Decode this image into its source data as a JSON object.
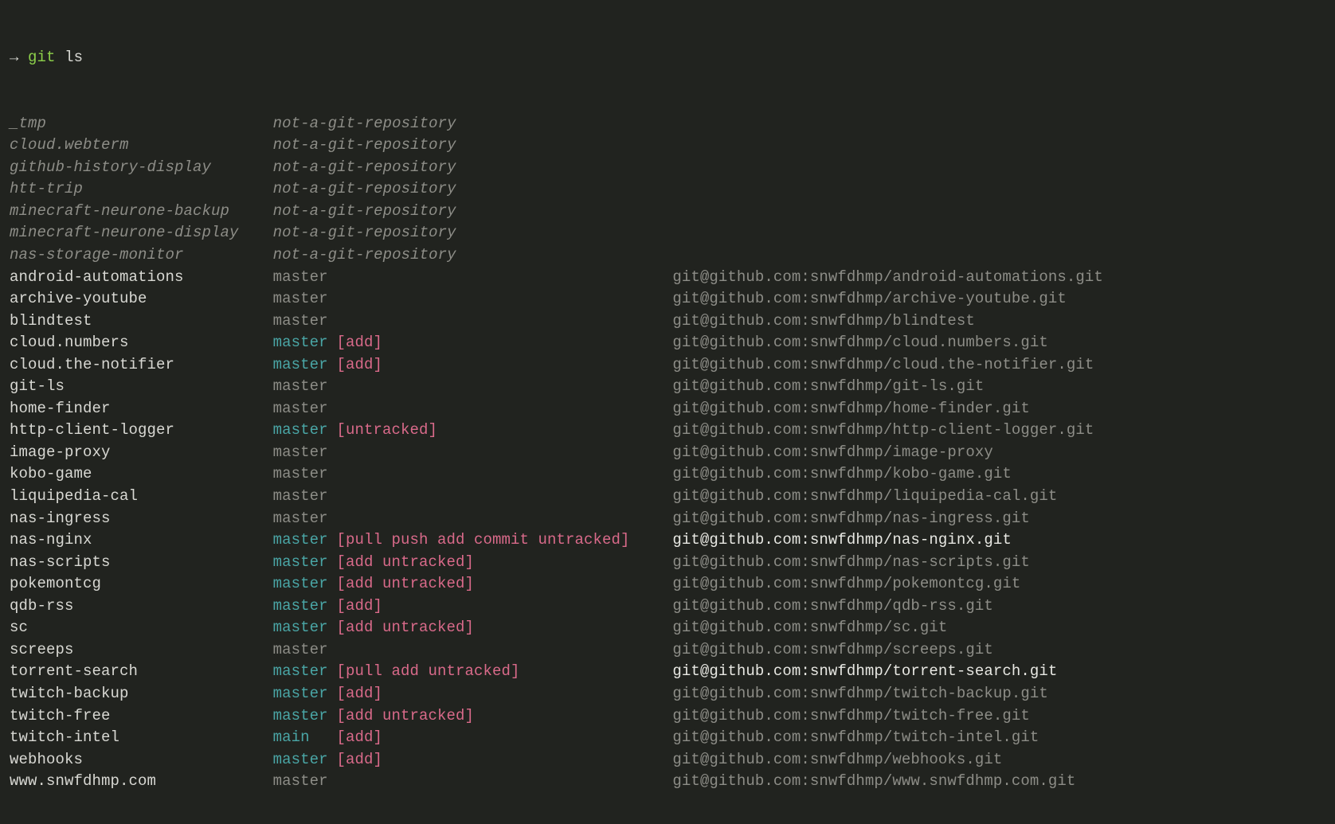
{
  "prompt": {
    "arrow": "→",
    "cmd": "git",
    "arg": "ls"
  },
  "notgit_label": "not-a-git-repository",
  "notgit": [
    "_tmp",
    "cloud.webterm",
    "github-history-display",
    "htt-trip",
    "minecraft-neurone-backup",
    "minecraft-neurone-display",
    "nas-storage-monitor"
  ],
  "repos": [
    {
      "dir": "android-automations",
      "branch": "master",
      "flags": "",
      "remote": "git@github.com:snwfdhmp/android-automations.git",
      "bright": false
    },
    {
      "dir": "archive-youtube",
      "branch": "master",
      "flags": "",
      "remote": "git@github.com:snwfdhmp/archive-youtube.git",
      "bright": false
    },
    {
      "dir": "blindtest",
      "branch": "master",
      "flags": "",
      "remote": "git@github.com:snwfdhmp/blindtest",
      "bright": false
    },
    {
      "dir": "cloud.numbers",
      "branch": "master",
      "flags": "[add]",
      "remote": "git@github.com:snwfdhmp/cloud.numbers.git",
      "bright": false
    },
    {
      "dir": "cloud.the-notifier",
      "branch": "master",
      "flags": "[add]",
      "remote": "git@github.com:snwfdhmp/cloud.the-notifier.git",
      "bright": false
    },
    {
      "dir": "git-ls",
      "branch": "master",
      "flags": "",
      "remote": "git@github.com:snwfdhmp/git-ls.git",
      "bright": false
    },
    {
      "dir": "home-finder",
      "branch": "master",
      "flags": "",
      "remote": "git@github.com:snwfdhmp/home-finder.git",
      "bright": false
    },
    {
      "dir": "http-client-logger",
      "branch": "master",
      "flags": "[untracked]",
      "remote": "git@github.com:snwfdhmp/http-client-logger.git",
      "bright": false
    },
    {
      "dir": "image-proxy",
      "branch": "master",
      "flags": "",
      "remote": "git@github.com:snwfdhmp/image-proxy",
      "bright": false
    },
    {
      "dir": "kobo-game",
      "branch": "master",
      "flags": "",
      "remote": "git@github.com:snwfdhmp/kobo-game.git",
      "bright": false
    },
    {
      "dir": "liquipedia-cal",
      "branch": "master",
      "flags": "",
      "remote": "git@github.com:snwfdhmp/liquipedia-cal.git",
      "bright": false
    },
    {
      "dir": "nas-ingress",
      "branch": "master",
      "flags": "",
      "remote": "git@github.com:snwfdhmp/nas-ingress.git",
      "bright": false
    },
    {
      "dir": "nas-nginx",
      "branch": "master",
      "flags": "[pull push add commit untracked]",
      "remote": "git@github.com:snwfdhmp/nas-nginx.git",
      "bright": true
    },
    {
      "dir": "nas-scripts",
      "branch": "master",
      "flags": "[add untracked]",
      "remote": "git@github.com:snwfdhmp/nas-scripts.git",
      "bright": false
    },
    {
      "dir": "pokemontcg",
      "branch": "master",
      "flags": "[add untracked]",
      "remote": "git@github.com:snwfdhmp/pokemontcg.git",
      "bright": false
    },
    {
      "dir": "qdb-rss",
      "branch": "master",
      "flags": "[add]",
      "remote": "git@github.com:snwfdhmp/qdb-rss.git",
      "bright": false
    },
    {
      "dir": "sc",
      "branch": "master",
      "flags": "[add untracked]",
      "remote": "git@github.com:snwfdhmp/sc.git",
      "bright": false
    },
    {
      "dir": "screeps",
      "branch": "master",
      "flags": "",
      "remote": "git@github.com:snwfdhmp/screeps.git",
      "bright": false
    },
    {
      "dir": "torrent-search",
      "branch": "master",
      "flags": "[pull add untracked]",
      "remote": "git@github.com:snwfdhmp/torrent-search.git",
      "bright": true
    },
    {
      "dir": "twitch-backup",
      "branch": "master",
      "flags": "[add]",
      "remote": "git@github.com:snwfdhmp/twitch-backup.git",
      "bright": false
    },
    {
      "dir": "twitch-free",
      "branch": "master",
      "flags": "[add untracked]",
      "remote": "git@github.com:snwfdhmp/twitch-free.git",
      "bright": false
    },
    {
      "dir": "twitch-intel",
      "branch": "main",
      "flags": "[add]",
      "remote": "git@github.com:snwfdhmp/twitch-intel.git",
      "bright": false
    },
    {
      "dir": "webhooks",
      "branch": "master",
      "flags": "[add]",
      "remote": "git@github.com:snwfdhmp/webhooks.git",
      "bright": false
    },
    {
      "dir": "www.snwfdhmp.com",
      "branch": "master",
      "flags": "",
      "remote": "git@github.com:snwfdhmp/www.snwfdhmp.com.git",
      "bright": false
    }
  ]
}
